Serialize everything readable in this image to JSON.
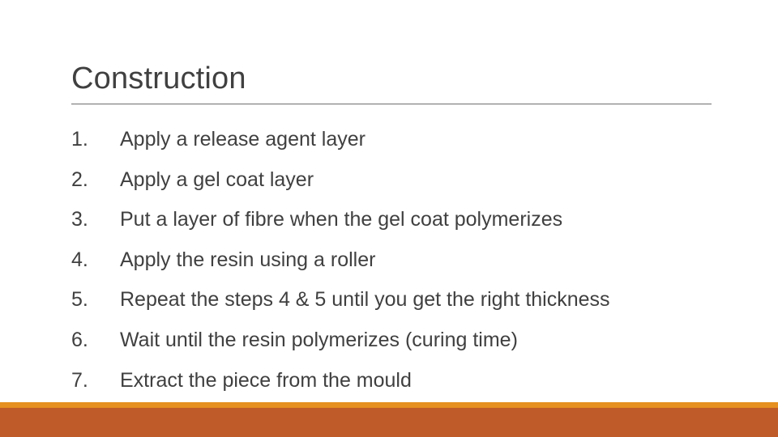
{
  "slide": {
    "title": "Construction",
    "steps": [
      {
        "number": "1.",
        "text": "Apply a release agent layer"
      },
      {
        "number": "2.",
        "text": "Apply a gel coat layer"
      },
      {
        "number": "3.",
        "text": "Put a layer of fibre when the gel coat polymerizes"
      },
      {
        "number": "4.",
        "text": "Apply the resin using a roller"
      },
      {
        "number": "5.",
        "text": "Repeat the steps 4 & 5 until you get the right thickness"
      },
      {
        "number": "6.",
        "text": "Wait until the resin polymerizes (curing time)"
      },
      {
        "number": "7.",
        "text": "Extract the piece from the mould"
      }
    ]
  },
  "colors": {
    "text": "#404040",
    "rule": "#6e6e6e",
    "band_amber": "#e59020",
    "band_terracotta": "#bf5a29",
    "background": "#ffffff"
  }
}
